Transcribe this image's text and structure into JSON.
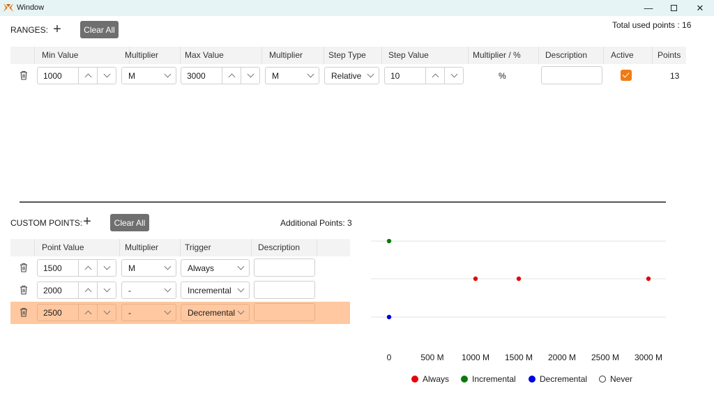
{
  "window": {
    "title": "Window",
    "minimize": "—",
    "close": "✕"
  },
  "ranges": {
    "label": "RANGES:",
    "clear_all": "Clear All",
    "total_used_points": "Total used points : 16",
    "columns": [
      "Min Value",
      "Multiplier",
      "Max Value",
      "Multiplier",
      "Step Type",
      "Step Value",
      "Multiplier / %",
      "Description",
      "Active",
      "Points"
    ],
    "rows": [
      {
        "min_value": "1000",
        "min_multiplier": "M",
        "max_value": "3000",
        "max_multiplier": "M",
        "step_type": "Relative",
        "step_value": "10",
        "step_multiplier": "%",
        "description": "",
        "active": true,
        "points": "13"
      }
    ]
  },
  "custom_points": {
    "label": "CUSTOM POINTS:",
    "clear_all": "Clear All",
    "additional_points": "Additional Points: 3",
    "columns": [
      "Point Value",
      "Multiplier",
      "Trigger",
      "Description"
    ],
    "rows": [
      {
        "point_value": "1500",
        "multiplier": "M",
        "trigger": "Always",
        "description": ""
      },
      {
        "point_value": "2000",
        "multiplier": "-",
        "trigger": "Incremental",
        "description": ""
      },
      {
        "point_value": "2500",
        "multiplier": "-",
        "trigger": "Decremental",
        "description": "",
        "selected": true
      }
    ]
  },
  "colors": {
    "accent": "#f07b12",
    "selected_row": "#ffc8a0",
    "always": "#e8000b",
    "incremental": "#0a7a0a",
    "decremental": "#0000e0",
    "button": "#6f6f6f"
  },
  "chart_data": {
    "type": "scatter",
    "xlim": [
      0,
      3000
    ],
    "tick_labels": [
      "0",
      "500 M",
      "1000 M",
      "1500 M",
      "2000 M",
      "2500 M",
      "3000 M"
    ],
    "tick_values": [
      0,
      500,
      1000,
      1500,
      2000,
      2500,
      3000
    ],
    "rows": [
      "Incremental",
      "Always",
      "Decremental"
    ],
    "series": [
      {
        "name": "Always",
        "color": "#e8000b",
        "row": "Always",
        "x": [
          1000,
          1500,
          3000
        ]
      },
      {
        "name": "Incremental",
        "color": "#0a7a0a",
        "row": "Incremental",
        "x": [
          0
        ]
      },
      {
        "name": "Decremental",
        "color": "#0000e0",
        "row": "Decremental",
        "x": [
          0
        ]
      },
      {
        "name": "Never",
        "color": "#ffffff",
        "row": "Never",
        "x": []
      }
    ],
    "legend": [
      "Always",
      "Incremental",
      "Decremental",
      "Never"
    ],
    "grid": true,
    "legend_position": "bottom"
  }
}
